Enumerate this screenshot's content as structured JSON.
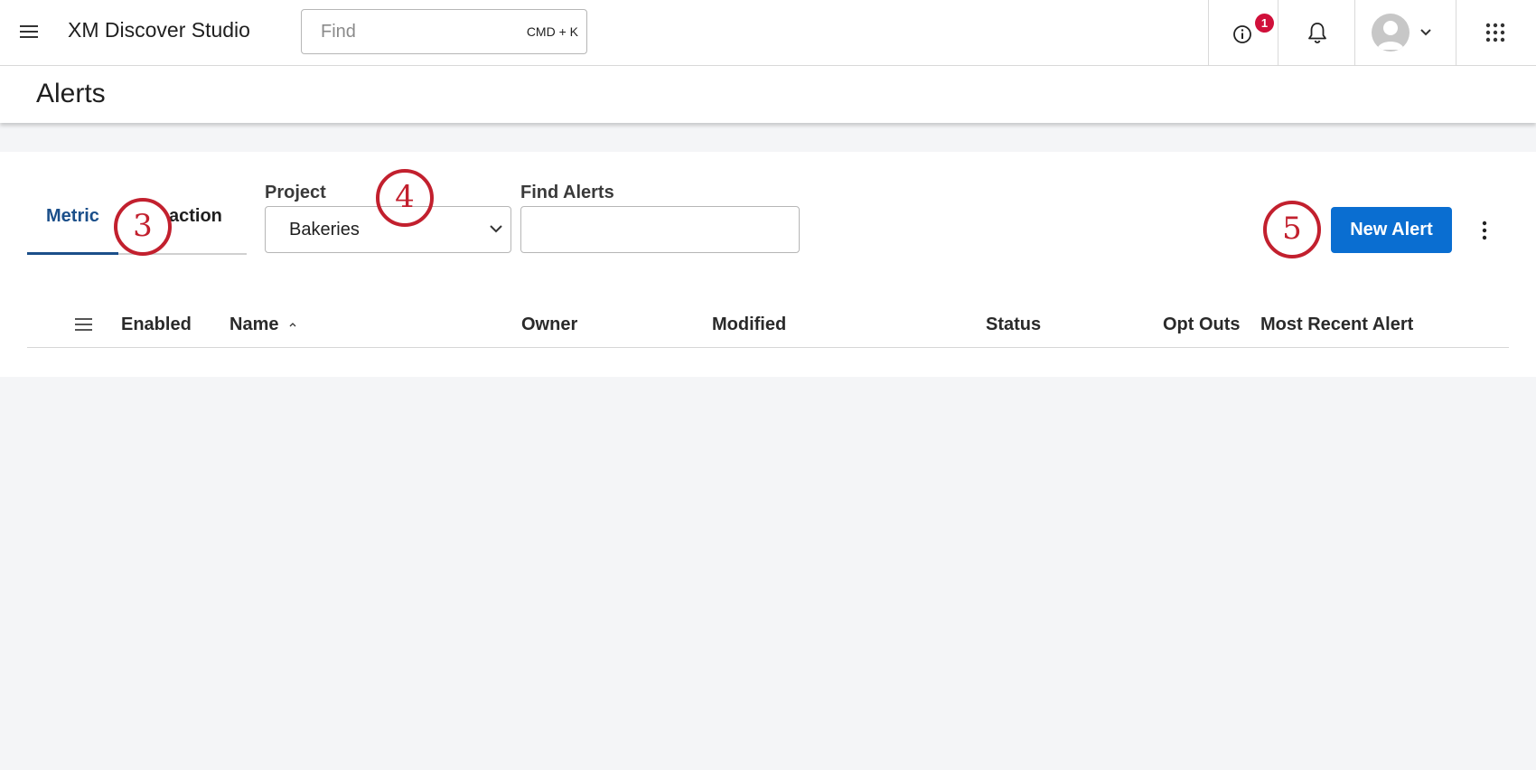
{
  "topbar": {
    "app_title": "XM Discover Studio",
    "search_placeholder": "Find",
    "search_shortcut": "CMD + K",
    "notification_badge": "1",
    "icons": [
      "menu-icon",
      "info-icon",
      "bell-icon",
      "avatar",
      "chevron-down-icon",
      "app-grid-icon"
    ]
  },
  "page": {
    "title": "Alerts"
  },
  "tabs": [
    {
      "label": "Metric",
      "active": true
    },
    {
      "label": "Transaction",
      "visible_text": "action",
      "active": false
    }
  ],
  "filters": {
    "project_label": "Project",
    "project_value": "Bakeries",
    "find_label": "Find Alerts",
    "find_value": ""
  },
  "actions": {
    "new_alert_label": "New Alert"
  },
  "table": {
    "columns": [
      "Enabled",
      "Name",
      "Owner",
      "Modified",
      "Status",
      "Opt Outs",
      "Most Recent Alert"
    ],
    "sort_column": "Name",
    "rows": []
  },
  "callouts": [
    "3",
    "4",
    "5"
  ],
  "colors": {
    "accent": "#0a6ed1",
    "active_tab": "#1b4f8a",
    "badge": "#d0103a",
    "callout": "#c2202e",
    "background": "#f4f5f7"
  }
}
